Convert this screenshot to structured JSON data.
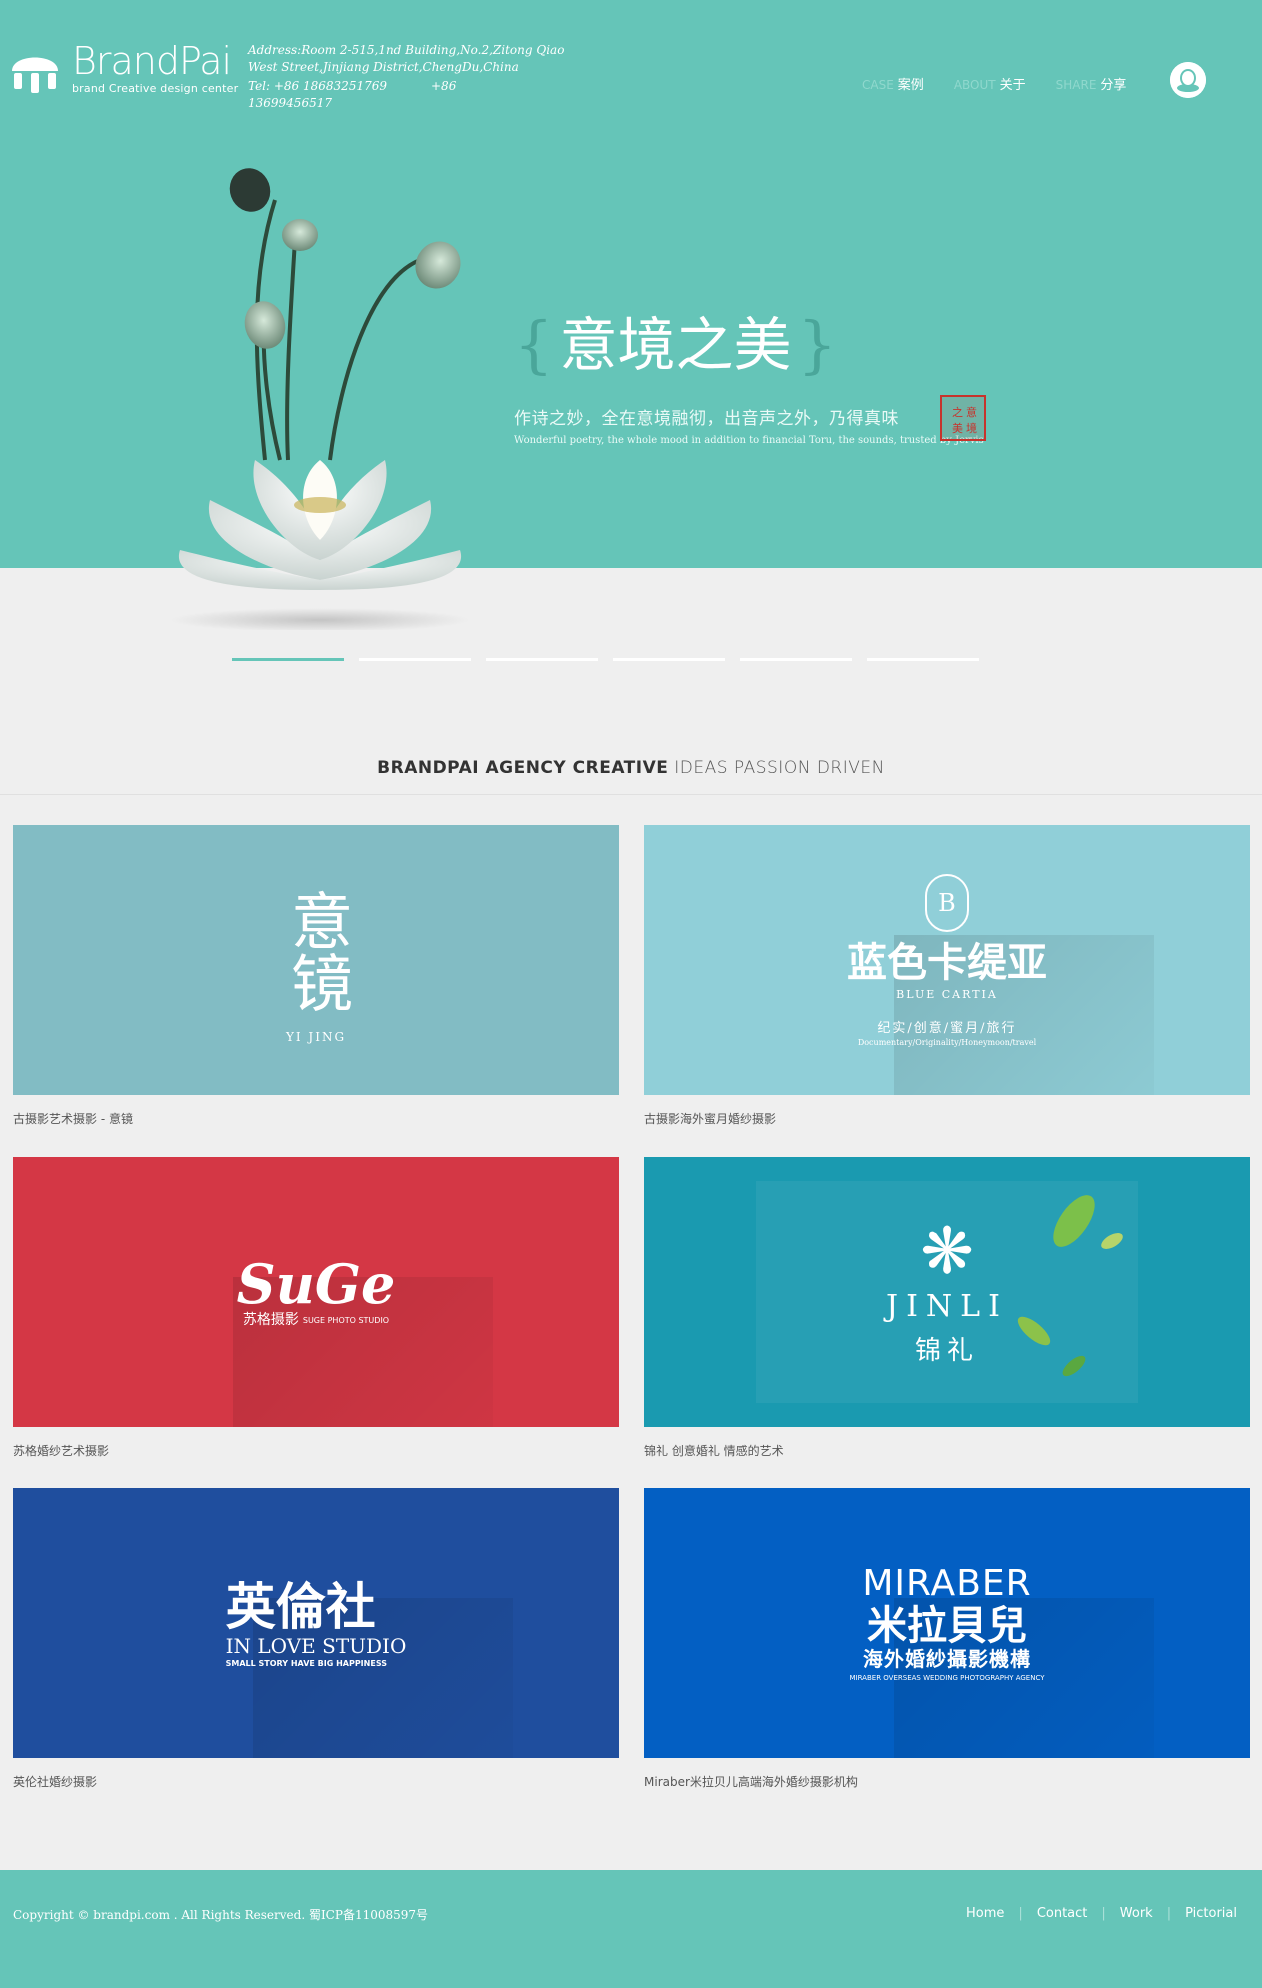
{
  "brand": {
    "name": "BrandPai",
    "tagline": "brand Creative design center"
  },
  "address": {
    "line1": "Address:Room   2-515,1nd   Building,No.2,Zitong   Qiao",
    "line2": "West Street,Jinjiang District,ChengDu,China",
    "tel_label_1": "Tel: +86 18683251769",
    "tel_2": "+86 13699456517"
  },
  "nav": [
    {
      "en": "CASE",
      "zh": "案例"
    },
    {
      "en": "ABOUT",
      "zh": "关于"
    },
    {
      "en": "SHARE",
      "zh": "分享"
    }
  ],
  "hero": {
    "title": "意境之美",
    "subtitle_zh": "作诗之妙，全在意境融彻，出音声之外，乃得真味",
    "subtitle_en": "Wonderful poetry, the whole mood in addition to financial Toru, the sounds, trusted by Jervis",
    "seal_text": "意境之美",
    "slides_total": 6,
    "active_slide": 1
  },
  "section": {
    "title_bold": "BRANDPAI AGENCY CREATIVE",
    "title_light": "IDEAS PASSION DRIVEN"
  },
  "cards": [
    {
      "caption": "古摄影艺术摄影 - 意镜",
      "logo_main": "意镜",
      "logo_sub": "YI JING",
      "bg": "#82bcc4"
    },
    {
      "caption": "古摄影海外蜜月婚纱摄影",
      "logo_mark": "B",
      "logo_main": "蓝色卡缇亚",
      "logo_sub": "BLUE CARTIA",
      "logo_tag": "纪实/创意/蜜月/旅行",
      "logo_tag2": "Documentary/Originality/Honeymoon/travel",
      "bg": "#90cfd8"
    },
    {
      "caption": "苏格婚纱艺术摄影",
      "logo_main": "SuGe",
      "logo_sub": "苏格摄影",
      "logo_tag": "SUGE PHOTO STUDIO",
      "bg": "#d43745"
    },
    {
      "caption": "锦礼 创意婚礼 情感的艺术",
      "logo_main": "JINLI",
      "logo_sub": "锦礼",
      "bg": "#1a9ab0"
    },
    {
      "caption": "英伦社婚纱摄影",
      "logo_main": "英倫社",
      "logo_sub": "IN LOVE STUDIO",
      "logo_tag": "SMALL STORY HAVE BIG HAPPINESS",
      "bg": "#1f4e9e"
    },
    {
      "caption": "Miraber米拉贝儿高端海外婚纱摄影机构",
      "logo_main": "MIRABER",
      "logo_sub": "米拉貝兒",
      "logo_sub2": "海外婚紗攝影機構",
      "logo_tag": "MIRABER OVERSEAS WEDDING PHOTOGRAPHY AGENCY",
      "bg": "#035fc3"
    }
  ],
  "footer": {
    "copyright": "Copyright © brandpi.com . All Rights Reserved. 蜀ICP备11008597号",
    "links": [
      "Home",
      "Contact",
      "Work",
      "Pictorial"
    ]
  }
}
